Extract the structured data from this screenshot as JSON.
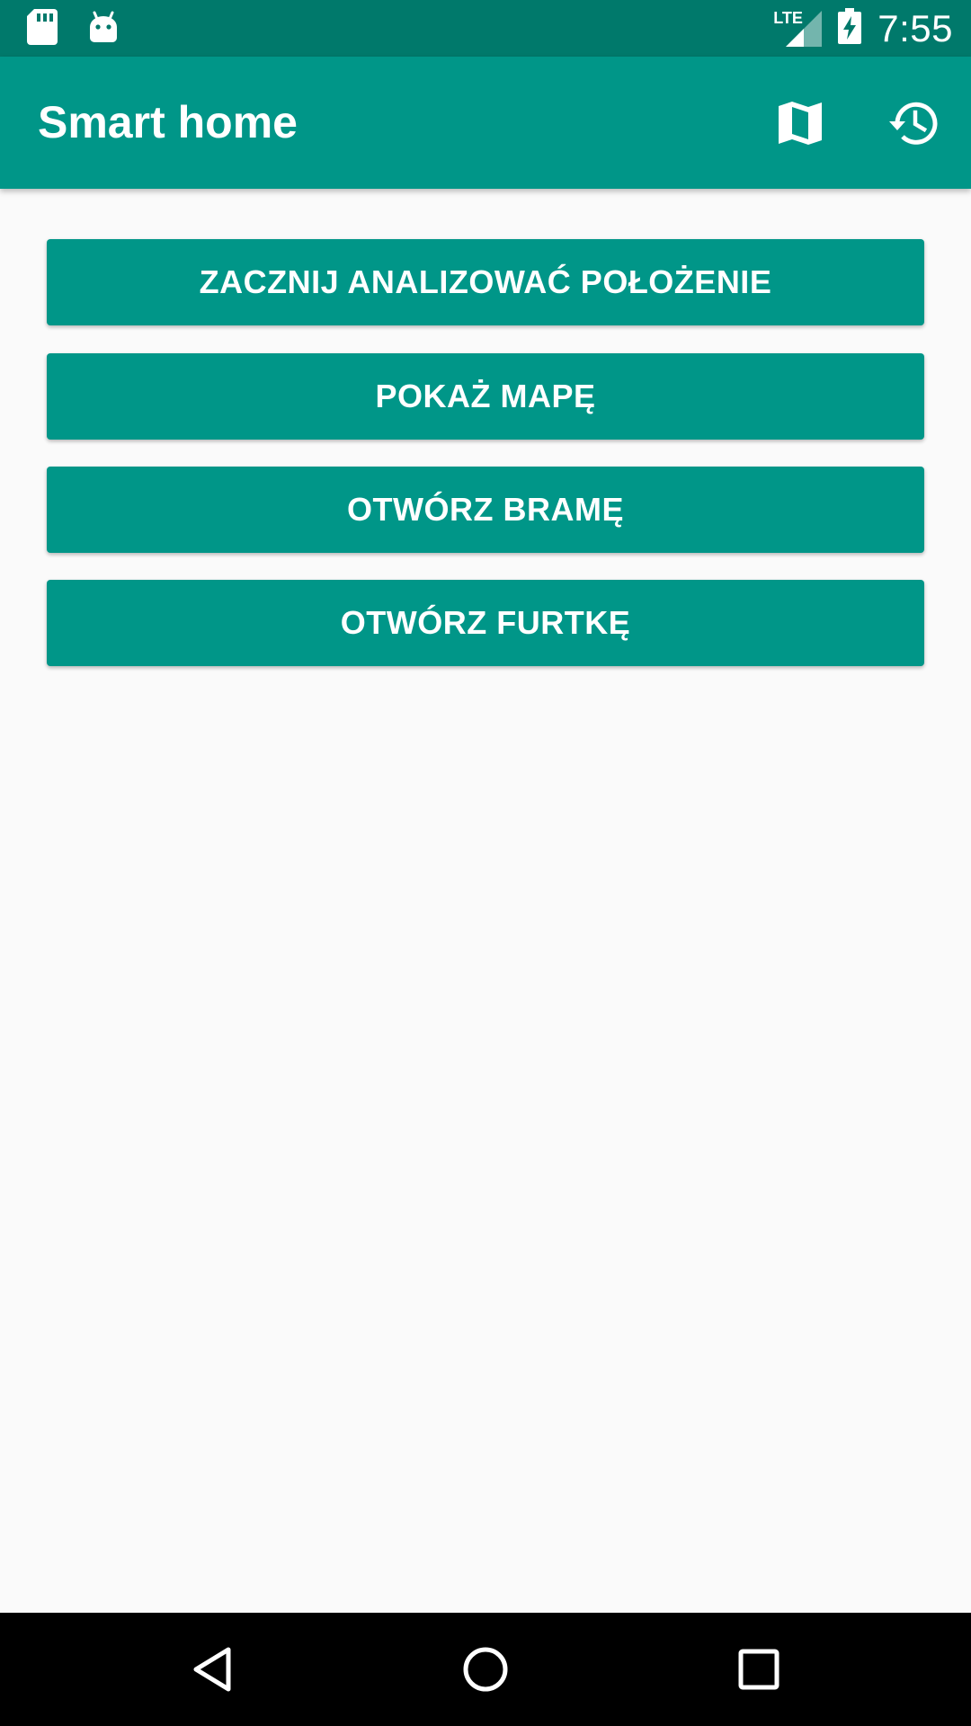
{
  "status_bar": {
    "time": "7:55",
    "network_label": "LTE",
    "icons": [
      "sd-card-icon",
      "android-icon",
      "lte-signal-icon",
      "battery-charging-icon"
    ]
  },
  "app_bar": {
    "title": "Smart home",
    "actions": [
      {
        "icon": "map-icon"
      },
      {
        "icon": "history-icon"
      }
    ]
  },
  "buttons": [
    {
      "label": "ZACZNIJ ANALIZOWAĆ POŁOŻENIE"
    },
    {
      "label": "POKAŻ MAPĘ"
    },
    {
      "label": "OTWÓRZ BRAMĘ"
    },
    {
      "label": "OTWÓRZ FURTKĘ"
    }
  ],
  "nav_bar": {
    "icons": [
      "back-icon",
      "home-icon",
      "recents-icon"
    ]
  },
  "colors": {
    "primary": "#009688",
    "primary_dark": "#00796b",
    "background": "#fafafa",
    "nav_background": "#000000"
  }
}
